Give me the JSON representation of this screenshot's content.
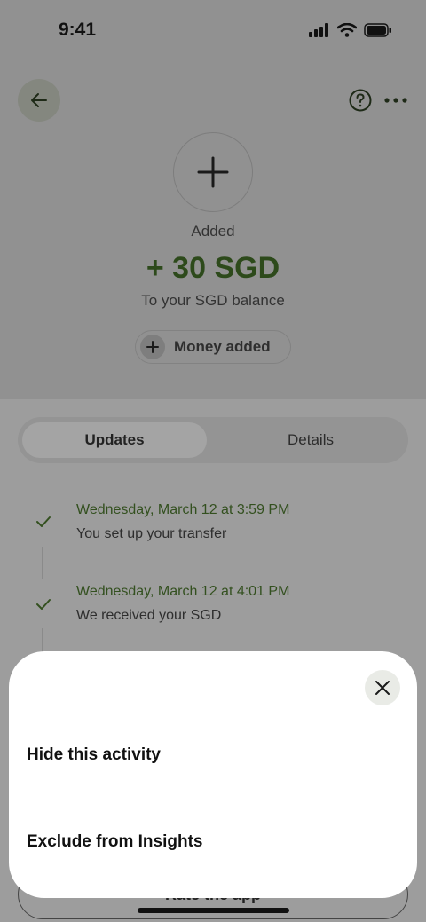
{
  "status_bar": {
    "time": "9:41"
  },
  "header": {
    "back_icon": "arrow-left-icon",
    "help_icon": "question-circle-icon",
    "more_icon": "more-horizontal-icon"
  },
  "transaction": {
    "icon": "plus-icon",
    "label": "Added",
    "amount": "+ 30 SGD",
    "subtitle": "To your SGD balance",
    "chip_label": "Money added"
  },
  "tabs": [
    {
      "label": "Updates",
      "active": true
    },
    {
      "label": "Details",
      "active": false
    }
  ],
  "timeline": [
    {
      "date": "Wednesday, March 12 at 3:59 PM",
      "description": "You set up your transfer"
    },
    {
      "date": "Wednesday, March 12 at 4:01 PM",
      "description": "We received your SGD"
    }
  ],
  "footer": {
    "rate_button": "Rate the app"
  },
  "sheet": {
    "close_icon": "close-icon",
    "options": [
      {
        "label": "Hide this activity"
      },
      {
        "label": "Exclude from Insights"
      }
    ]
  },
  "colors": {
    "accent_green": "#2d4a1b",
    "overlay": "#919191",
    "sheet_bg": "#ffffff"
  }
}
